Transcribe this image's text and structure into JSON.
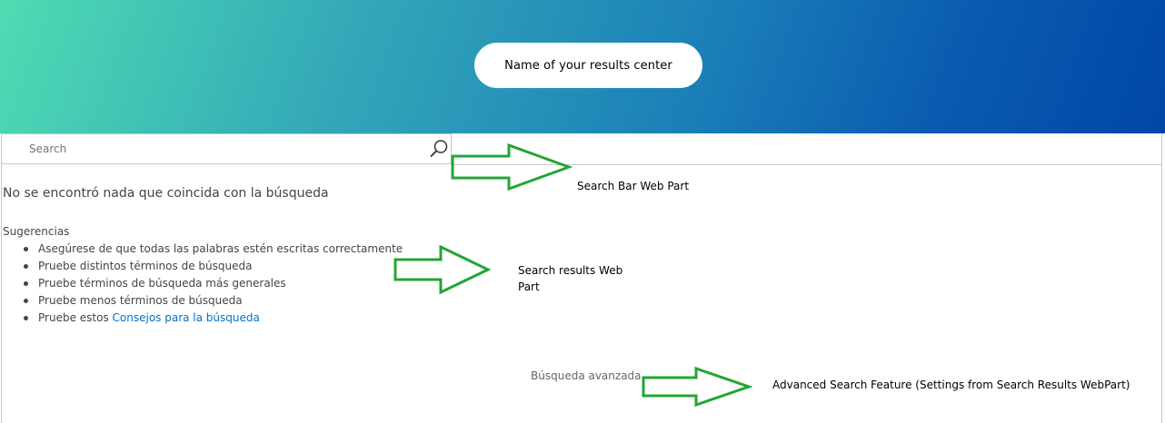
{
  "banner": {
    "title": "Name of your results center"
  },
  "search": {
    "placeholder": "Search",
    "value": "Search"
  },
  "results": {
    "no_results_message": "No se encontró nada que coincida con la búsqueda",
    "suggestions_title": "Sugerencias",
    "suggestions": [
      "Asegúrese de que todas las palabras estén escritas correctamente",
      "Pruebe distintos términos de búsqueda",
      "Pruebe términos de búsqueda más generales",
      "Pruebe menos términos de búsqueda"
    ],
    "last_suggestion_prefix": "Pruebe estos",
    "last_suggestion_link": "Consejos para la búsqueda",
    "advanced_search_link": "Búsqueda avanzada"
  },
  "annotations": {
    "search_bar": "Search Bar Web Part",
    "search_results_line1": "Search results Web",
    "search_results_line2": "Part",
    "advanced_search": "Advanced Search Feature (Settings from Search Results WebPart)"
  },
  "colors": {
    "banner_start": "#4fdcb2",
    "banner_end": "#0046a8",
    "link": "#0072c6",
    "arrow": "#22a534"
  },
  "icons": {
    "search_button": "search-icon",
    "annotation_arrows": "right-arrow-icon"
  }
}
